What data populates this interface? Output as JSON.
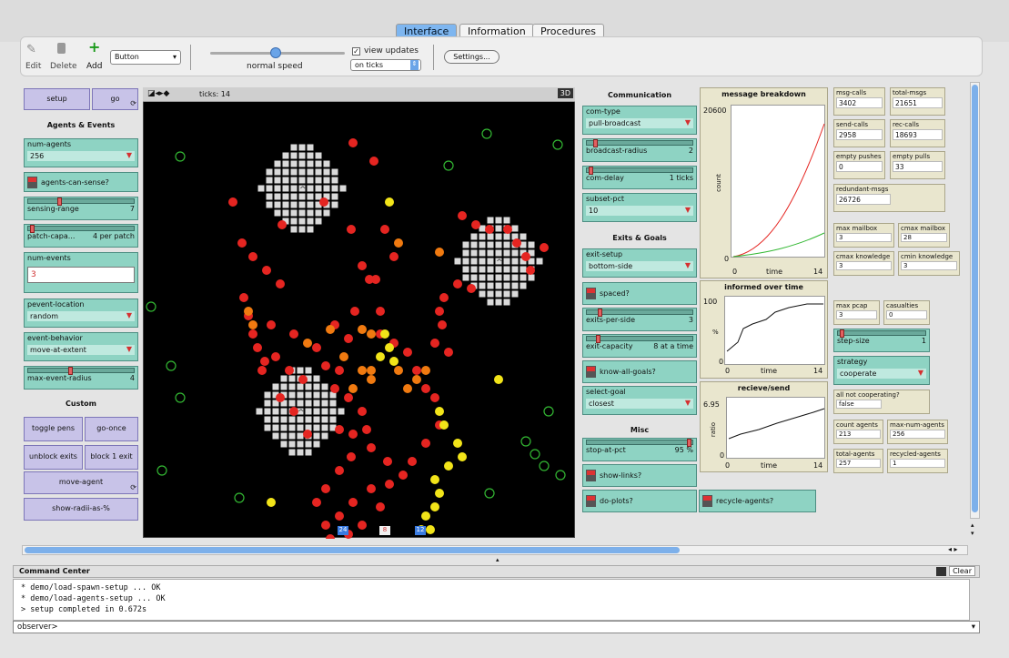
{
  "tabs": [
    "Interface",
    "Information",
    "Procedures"
  ],
  "toolbar": {
    "edit": "Edit",
    "delete": "Delete",
    "add": "Add",
    "widget_type": "Button",
    "speed_label": "normal speed",
    "view_updates": "view updates",
    "update_mode": "on ticks",
    "settings": "Settings..."
  },
  "view": {
    "ticks_label": "ticks: 14",
    "threed": "3D"
  },
  "left": {
    "setup": "setup",
    "go": "go",
    "agents_events": "Agents & Events",
    "num_agents_label": "num-agents",
    "num_agents_val": "256",
    "agents_can_sense": "agents-can-sense?",
    "sensing_range_label": "sensing-range",
    "sensing_range_val": "7",
    "patch_capa_label": "patch-capa...",
    "patch_capa_val": "4 per patch",
    "num_events_label": "num-events",
    "num_events_val": "3",
    "pevent_location_label": "pevent-location",
    "pevent_location_val": "random",
    "event_behavior_label": "event-behavior",
    "event_behavior_val": "move-at-extent",
    "max_event_radius_label": "max-event-radius",
    "max_event_radius_val": "4",
    "custom": "Custom",
    "toggle_pens": "toggle pens",
    "go_once": "go-once",
    "unblock_exits": "unblock exits",
    "block_1_exit": "block 1 exit",
    "move_agent": "move-agent",
    "show_radii": "show-radii-as-%"
  },
  "mid": {
    "communication": "Communication",
    "com_type_label": "com-type",
    "com_type_val": "pull-broadcast",
    "broadcast_radius_label": "broadcast-radius",
    "broadcast_radius_val": "2",
    "com_delay_label": "com-delay",
    "com_delay_val": "1 ticks",
    "subset_pct_label": "subset-pct",
    "subset_pct_val": "10",
    "exits_goals": "Exits & Goals",
    "exit_setup_label": "exit-setup",
    "exit_setup_val": "bottom-side",
    "spaced": "spaced?",
    "exits_per_side_label": "exits-per-side",
    "exits_per_side_val": "3",
    "exit_capacity_label": "exit-capacity",
    "exit_capacity_val": "8 at a time",
    "know_all_goals": "know-all-goals?",
    "select_goal_label": "select-goal",
    "select_goal_val": "closest",
    "misc": "Misc",
    "stop_at_pct_label": "stop-at-pct",
    "stop_at_pct_val": "95 %",
    "show_links": "show-links?",
    "do_plots": "do-plots?",
    "recycle_agents": "recycle-agents?",
    "on": "On",
    "off": "Off"
  },
  "plots": {
    "p1_title": "message breakdown",
    "p1_ymax": "20600",
    "p1_ylabel": "count",
    "p1_xmin": "0",
    "p1_xlabel": "time",
    "p1_xmax": "14",
    "p1_ymin": "0",
    "p2_title": "informed over time",
    "p2_ymax": "100",
    "p2_ylabel": "%",
    "p2_xmin": "0",
    "p2_xlabel": "time",
    "p2_xmax": "14",
    "p2_ymin": "0",
    "p3_title": "recieve/send",
    "p3_ymax": "6.95",
    "p3_ylabel": "ratio",
    "p3_xmin": "0",
    "p3_xlabel": "time",
    "p3_xmax": "14",
    "p3_ymin": "0"
  },
  "monitors": [
    {
      "label": "msg-calls",
      "value": "3402"
    },
    {
      "label": "total-msgs",
      "value": "21651"
    },
    {
      "label": "send-calls",
      "value": "2958"
    },
    {
      "label": "rec-calls",
      "value": "18693"
    },
    {
      "label": "empty pushes",
      "value": "0"
    },
    {
      "label": "empty pulls",
      "value": "33"
    },
    {
      "label": "redundant-msgs",
      "value": "26726"
    },
    {
      "label": "max mailbox",
      "value": "3"
    },
    {
      "label": "cmax mailbox",
      "value": "28"
    },
    {
      "label": "cmax knowledge",
      "value": "3"
    },
    {
      "label": "cmin knowledge",
      "value": "3"
    },
    {
      "label": "max pcap",
      "value": "3"
    },
    {
      "label": "casualties",
      "value": "0"
    },
    {
      "label": "all not cooperating?",
      "value": "false"
    },
    {
      "label": "count agents",
      "value": "213"
    },
    {
      "label": "max-num-agents",
      "value": "256"
    },
    {
      "label": "total-agents",
      "value": "257"
    },
    {
      "label": "recycled-agents",
      "value": "1"
    }
  ],
  "right": {
    "step_size_label": "step-size",
    "step_size_val": "1",
    "strategy_label": "strategy",
    "strategy_val": "cooperate"
  },
  "command": {
    "title": "Command Center",
    "clear": "Clear",
    "line1": "* demo/load-spawn-setup ... OK",
    "line2": "* demo/load-agents-setup ... OK",
    "line3": "> setup completed in 0.672s",
    "prompt": "observer>"
  },
  "exits": [
    "24",
    "8",
    "12"
  ],
  "colors": {
    "red": "#e52521",
    "orange": "#f07a10",
    "yellow": "#f2e419",
    "green": "#33b833",
    "patch": "#dadada"
  }
}
